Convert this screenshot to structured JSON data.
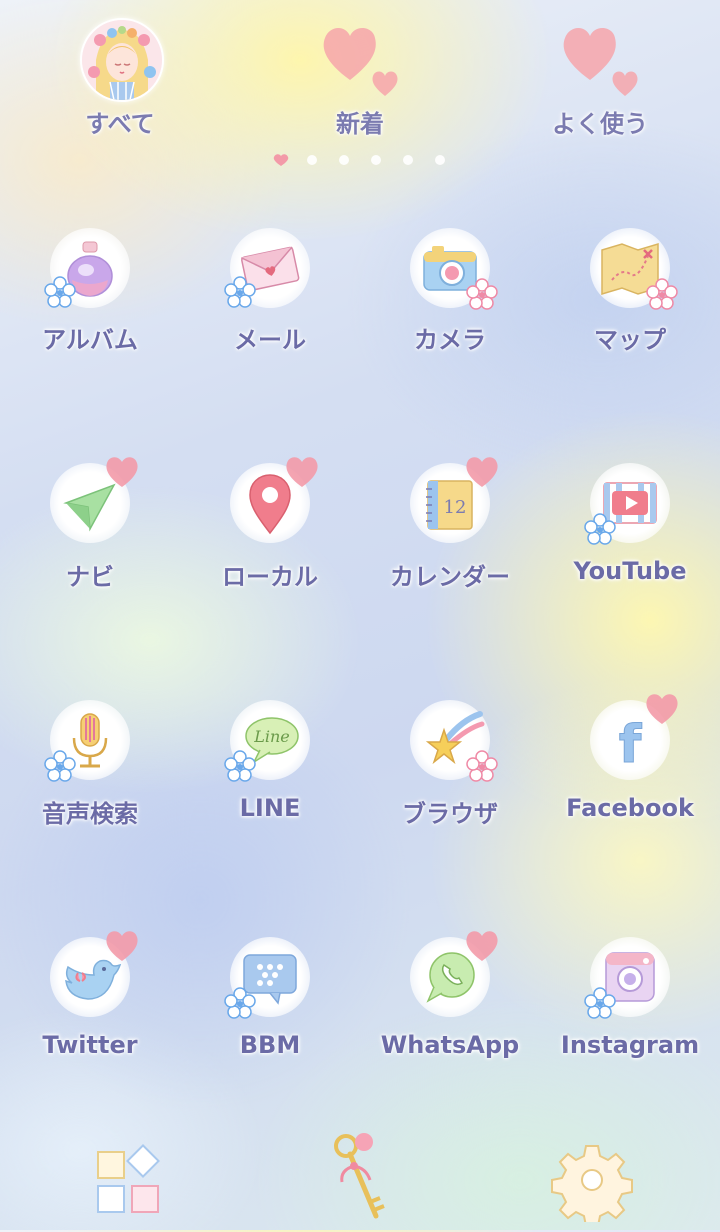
{
  "top_tabs": [
    {
      "label": "すべて",
      "icon": "girl-avatar-icon"
    },
    {
      "label": "新着",
      "icon": "heart-icon"
    },
    {
      "label": "よく使う",
      "icon": "heart-icon"
    }
  ],
  "page_indicator": {
    "pages": 6,
    "current": 1
  },
  "apps": [
    {
      "label": "アルバム",
      "icon": "perfume-bottle-icon"
    },
    {
      "label": "メール",
      "icon": "envelope-icon"
    },
    {
      "label": "カメラ",
      "icon": "camera-icon"
    },
    {
      "label": "マップ",
      "icon": "treasure-map-icon"
    },
    {
      "label": "ナビ",
      "icon": "navigation-arrow-icon"
    },
    {
      "label": "ローカル",
      "icon": "location-pin-icon"
    },
    {
      "label": "カレンダー",
      "icon": "calendar-icon",
      "calendar_day": "12"
    },
    {
      "label": "YouTube",
      "icon": "youtube-play-icon"
    },
    {
      "label": "音声検索",
      "icon": "microphone-icon"
    },
    {
      "label": "LINE",
      "icon": "line-bubble-icon",
      "bubble_text": "Line"
    },
    {
      "label": "ブラウザ",
      "icon": "shooting-star-icon"
    },
    {
      "label": "Facebook",
      "icon": "facebook-icon",
      "glyph": "f"
    },
    {
      "label": "Twitter",
      "icon": "bird-icon"
    },
    {
      "label": "BBM",
      "icon": "bbm-bubble-icon"
    },
    {
      "label": "WhatsApp",
      "icon": "phone-bubble-icon"
    },
    {
      "label": "Instagram",
      "icon": "instagram-camera-icon"
    }
  ],
  "dock": [
    {
      "icon": "app-drawer-icon"
    },
    {
      "icon": "key-icon"
    },
    {
      "icon": "gear-icon"
    }
  ],
  "colors": {
    "label": "#6b6ba6",
    "heart": "#f08a9a",
    "flower": "#7fb6ee"
  }
}
